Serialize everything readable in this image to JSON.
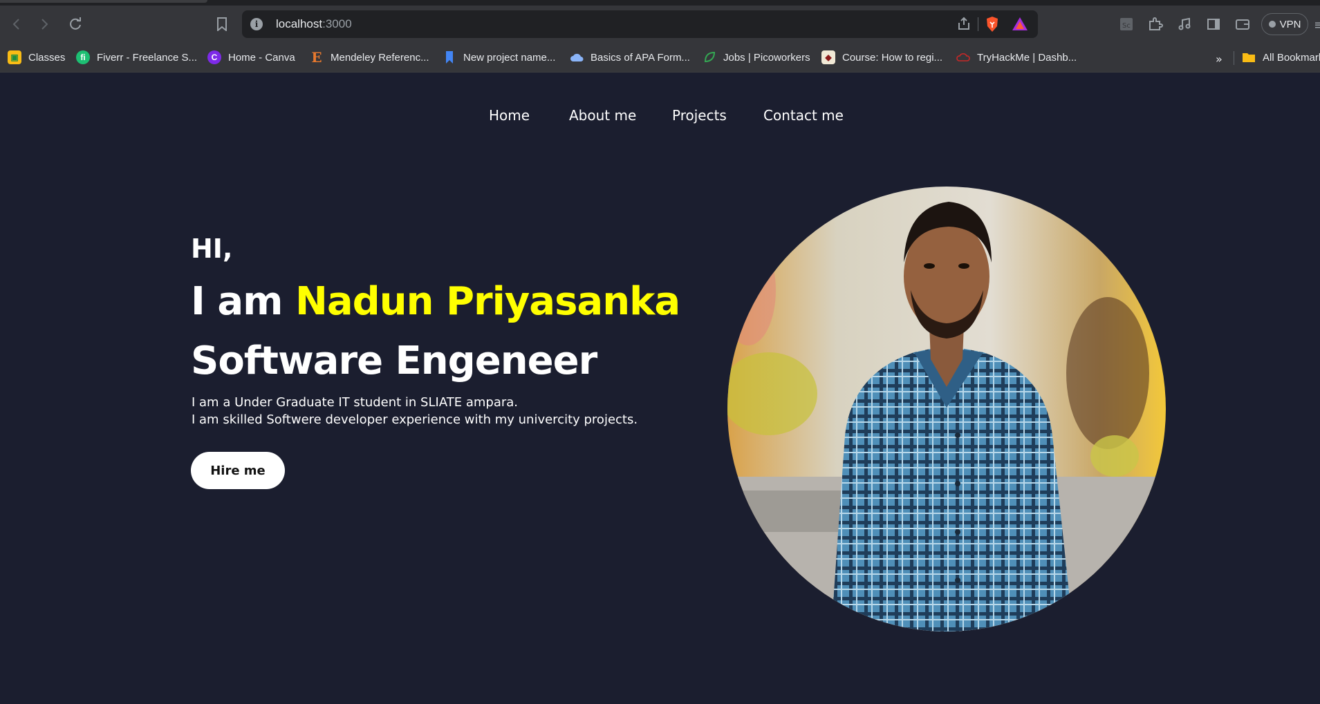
{
  "browser": {
    "url_host": "localhost",
    "url_port": ":3000",
    "vpn_label": "VPN",
    "bookmarks": [
      {
        "label": "Classes",
        "icon": "classroom-icon"
      },
      {
        "label": "Fiverr - Freelance S...",
        "icon": "fiverr-icon"
      },
      {
        "label": "Home - Canva",
        "icon": "canva-icon"
      },
      {
        "label": "Mendeley Referenc...",
        "icon": "mendeley-icon"
      },
      {
        "label": "New project name...",
        "icon": "bookmark-blue-icon"
      },
      {
        "label": "Basics of APA Form...",
        "icon": "cloud-icon"
      },
      {
        "label": "Jobs | Picoworkers",
        "icon": "leaf-icon"
      },
      {
        "label": "Course: How to regi...",
        "icon": "university-icon"
      },
      {
        "label": "TryHackMe | Dashb...",
        "icon": "tryhackme-icon"
      }
    ],
    "more_label": "»",
    "all_bookmarks": "All Bookmarks"
  },
  "nav": {
    "items": [
      "Home",
      "About me",
      "Projects",
      "Contact me"
    ]
  },
  "hero": {
    "greeting": "HI,",
    "intro_prefix": "I am ",
    "name": "Nadun Priyasanka",
    "role": "Software Engeneer",
    "desc_line1": "I am a Under Graduate IT student in SLIATE ampara.",
    "desc_line2": "I am skilled Softwere developer experience with my univercity projects.",
    "cta": "Hire me"
  },
  "colors": {
    "page_bg": "#1b1e2f",
    "highlight": "#ffff00",
    "text": "#ffffff",
    "button_bg": "#ffffff"
  }
}
